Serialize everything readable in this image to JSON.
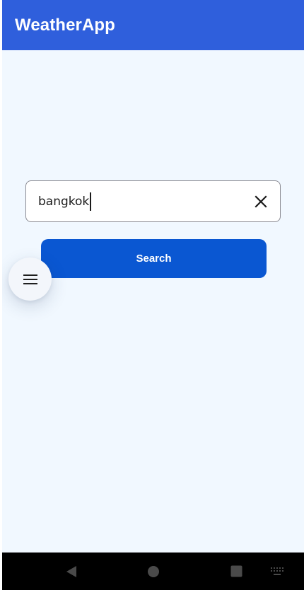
{
  "app_bar": {
    "title": "WeatherApp",
    "color": "#2f5fdc"
  },
  "search": {
    "value": "bangkok",
    "clear_icon": "close-icon"
  },
  "search_button": {
    "label": "Search",
    "color": "#0a57d2"
  },
  "fab": {
    "icon": "menu-icon"
  },
  "system_nav": {
    "buttons": [
      "back-icon",
      "home-icon",
      "recents-icon",
      "keyboard-icon"
    ]
  },
  "colors": {
    "background": "#f1f8ff",
    "nav_bar": "#000000"
  }
}
